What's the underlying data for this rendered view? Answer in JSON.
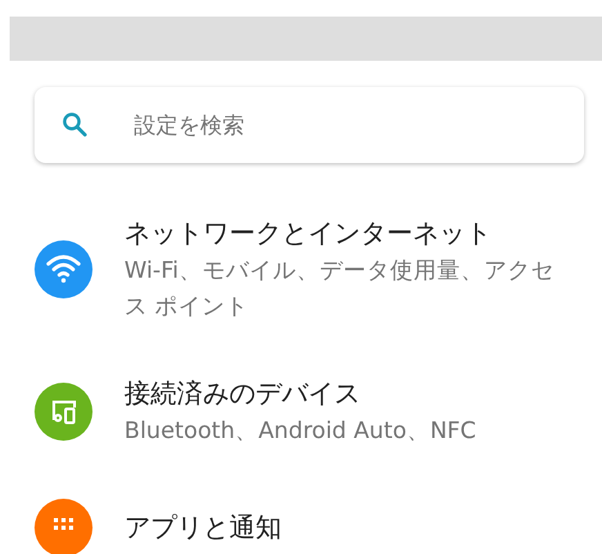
{
  "search": {
    "placeholder": "設定を検索"
  },
  "items": [
    {
      "kind": "network",
      "color": "#2196f3",
      "title": "ネットワークとインターネット",
      "subtitle": "Wi-Fi、モバイル、データ使用量、アクセス ポイント"
    },
    {
      "kind": "devices",
      "color": "#6ab41e",
      "title": "接続済みのデバイス",
      "subtitle": "Bluetooth、Android Auto、NFC"
    },
    {
      "kind": "apps",
      "color": "#ff6f00",
      "title": "アプリと通知"
    }
  ]
}
